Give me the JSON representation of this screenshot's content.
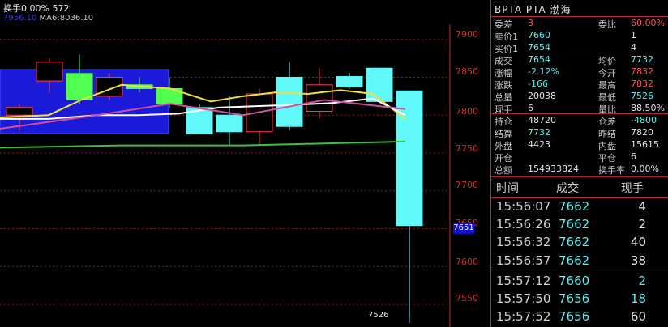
{
  "header": {
    "turnover_label": "换手0.00% 572",
    "ma_label_5": "7956.10",
    "ma_label_6": "MA6:8036.10"
  },
  "chart": {
    "y_ticks": [
      "7900",
      "7850",
      "7800",
      "7750",
      "7700",
      "7650",
      "7600",
      "7550"
    ],
    "current_price_tag": "7651",
    "low_label": "7526"
  },
  "chart_data": {
    "type": "candlestick",
    "ylim": [
      7520,
      7920
    ],
    "candles": [
      {
        "open": 7810,
        "close": 7800,
        "high": 7815,
        "low": 7780,
        "color": "red"
      },
      {
        "open": 7845,
        "close": 7870,
        "high": 7875,
        "low": 7830,
        "color": "red"
      },
      {
        "open": 7820,
        "close": 7855,
        "high": 7880,
        "low": 7815,
        "color": "green"
      },
      {
        "open": 7825,
        "close": 7850,
        "high": 7855,
        "low": 7820,
        "color": "red"
      },
      {
        "open": 7840,
        "close": 7835,
        "high": 7850,
        "low": 7830,
        "color": "green"
      },
      {
        "open": 7815,
        "close": 7835,
        "high": 7850,
        "low": 7810,
        "color": "green"
      },
      {
        "open": 7810,
        "close": 7775,
        "high": 7815,
        "low": 7775,
        "color": "cyan"
      },
      {
        "open": 7800,
        "close": 7778,
        "high": 7825,
        "low": 7760,
        "color": "cyan"
      },
      {
        "open": 7778,
        "close": 7828,
        "high": 7835,
        "low": 7760,
        "color": "red"
      },
      {
        "open": 7850,
        "close": 7785,
        "high": 7870,
        "low": 7780,
        "color": "cyan"
      },
      {
        "open": 7805,
        "close": 7840,
        "high": 7862,
        "low": 7795,
        "color": "red"
      },
      {
        "open": 7837,
        "close": 7851,
        "high": 7856,
        "low": 7835,
        "color": "cyan"
      },
      {
        "open": 7862,
        "close": 7818,
        "high": 7862,
        "low": 7818,
        "color": "cyan"
      },
      {
        "open": 7832,
        "close": 7654,
        "high": 7832,
        "low": 7526,
        "color": "cyan"
      }
    ]
  },
  "panel": {
    "title": "BPTA  PTA  渤海",
    "rows": [
      {
        "l1": "委差",
        "v1": "3",
        "c1": "red",
        "l2": "委比",
        "v2": "60.00%",
        "c2": "red"
      },
      {
        "l1": "卖价1",
        "v1": "7660",
        "c1": "cyan",
        "l2": "",
        "v2": "1",
        "c2": "white"
      },
      {
        "l1": "买价1",
        "v1": "7654",
        "c1": "cyan",
        "l2": "",
        "v2": "4",
        "c2": "white"
      },
      {
        "l1": "成交",
        "v1": "7654",
        "c1": "cyan",
        "l2": "均价",
        "v2": "7732",
        "c2": "cyan"
      },
      {
        "l1": "涨幅",
        "v1": "-2.12%",
        "c1": "cyan",
        "l2": "今开",
        "v2": "7832",
        "c2": "red"
      },
      {
        "l1": "涨跌",
        "v1": "-166",
        "c1": "cyan",
        "l2": "最高",
        "v2": "7832",
        "c2": "red"
      },
      {
        "l1": "总量",
        "v1": "20038",
        "c1": "white",
        "l2": "最低",
        "v2": "7526",
        "c2": "cyan"
      },
      {
        "l1": "现手",
        "v1": "6",
        "c1": "white",
        "l2": "量比",
        "v2": "88.50%",
        "c2": "white"
      },
      {
        "l1": "持仓",
        "v1": "48720",
        "c1": "white",
        "l2": "仓差",
        "v2": "-4800",
        "c2": "cyan"
      },
      {
        "l1": "结算",
        "v1": "7732",
        "c1": "cyan",
        "l2": "昨结",
        "v2": "7820",
        "c2": "white"
      },
      {
        "l1": "外盘",
        "v1": "4423",
        "c1": "white",
        "l2": "内盘",
        "v2": "15615",
        "c2": "white"
      },
      {
        "l1": "开仓",
        "v1": "",
        "c1": "white",
        "l2": "平仓",
        "v2": "6",
        "c2": "white"
      },
      {
        "l1": "总额",
        "v1": "154933824",
        "c1": "white",
        "l2": "换手率",
        "v2": "0.00%",
        "c2": "white"
      }
    ],
    "ticks_header": {
      "time": "时间",
      "price": "成交",
      "qty": "现手"
    },
    "ticks": [
      {
        "time": "15:56:07",
        "price": "7662",
        "qty": "4",
        "qc": "white"
      },
      {
        "time": "15:56:26",
        "price": "7662",
        "qty": "2",
        "qc": "white"
      },
      {
        "time": "15:56:32",
        "price": "7662",
        "qty": "40",
        "qc": "white"
      },
      {
        "time": "15:56:57",
        "price": "7662",
        "qty": "38",
        "qc": "white"
      },
      {
        "time": "15:57:12",
        "price": "7660",
        "qty": "2",
        "qc": "cyan"
      },
      {
        "time": "15:57:50",
        "price": "7656",
        "qty": "18",
        "qc": "cyan"
      },
      {
        "time": "15:57:52",
        "price": "7656",
        "qty": "60",
        "qc": "white"
      }
    ]
  }
}
